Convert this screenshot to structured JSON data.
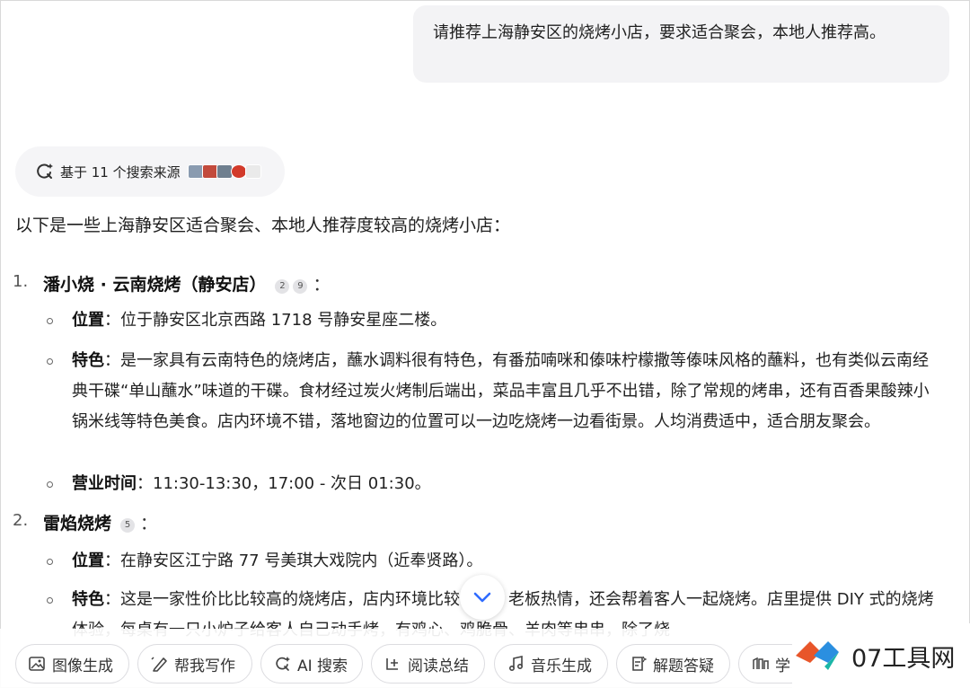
{
  "user_message": "请推荐上海静安区的烧烤小店，要求适合聚会，本地人推荐高。",
  "sources": {
    "label": "基于 11 个搜索来源"
  },
  "intro": "以下是一些上海静安区适合聚会、本地人推荐度较高的烧烤小店：",
  "shops": [
    {
      "number": "1.",
      "name": "潘小烧 · 云南烧烤（静安店）",
      "refs": [
        "2",
        "9"
      ],
      "colon": "：",
      "details": [
        {
          "label": "位置",
          "text": "：位于静安区北京西路 1718 号静安星座二楼。"
        },
        {
          "label": "特色",
          "text": "：是一家具有云南特色的烧烤店，蘸水调料很有特色，有番茄喃咪和傣味柠檬撒等傣味风格的蘸料，也有类似云南经典干碟“单山蘸水”味道的干碟。食材经过炭火烤制后端出，菜品丰富且几乎不出错，除了常规的烤串，还有百香果酸辣小锅米线等特色美食。店内环境不错，落地窗边的位置可以一边吃烧烤一边看街景。人均消费适中，适合朋友聚会。"
        },
        {
          "label": "营业时间",
          "text": "：11:30-13:30，17:00 - 次日 01:30。"
        }
      ]
    },
    {
      "number": "2.",
      "name": "雷焰烧烤",
      "refs": [
        "5"
      ],
      "colon": "：",
      "details": [
        {
          "label": "位置",
          "text": "：在静安区江宁路 77 号美琪大戏院内（近奉贤路）。"
        },
        {
          "label": "特色",
          "text": "：这是一家性价比比较高的烧烤店，店内环境比较优雅。老板热情，还会帮着客人一起烧烤。店里提供 DIY 式的烧烤体验，每桌有一只小炉子给客人自己动手烤，有鸡心、鸡脆骨、羊肉等串串，除了烧"
        }
      ]
    }
  ],
  "toolbar": {
    "chips": [
      {
        "label": "图像生成",
        "icon": "image-icon"
      },
      {
        "label": "帮我写作",
        "icon": "pen-icon"
      },
      {
        "label": "AI 搜索",
        "icon": "ai-search-icon"
      },
      {
        "label": "阅读总结",
        "icon": "read-icon"
      },
      {
        "label": "音乐生成",
        "icon": "music-icon"
      },
      {
        "label": "解题答疑",
        "icon": "solve-icon"
      },
      {
        "label": "学",
        "icon": "study-icon"
      }
    ]
  },
  "watermark": {
    "text": "07工具网",
    "colors": [
      "#e8562a",
      "#2b8fe0",
      "#1bb6a6"
    ]
  }
}
